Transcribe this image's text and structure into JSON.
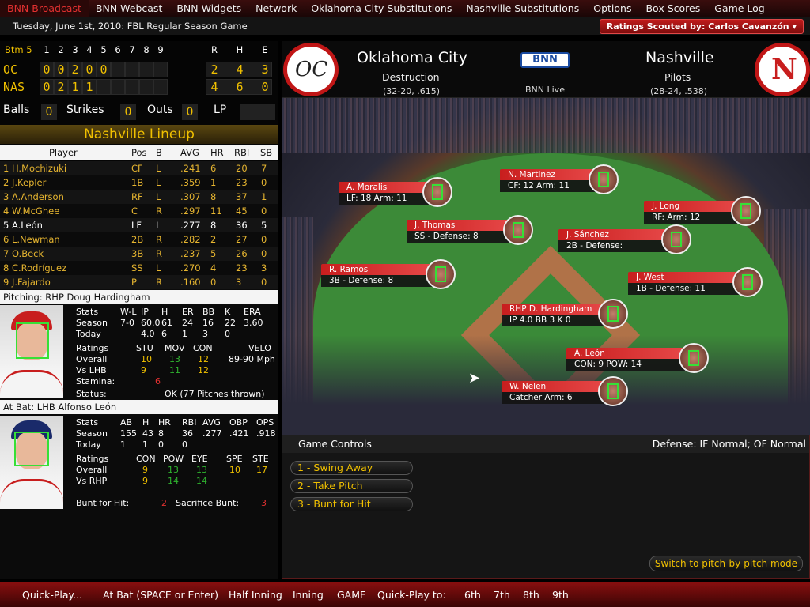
{
  "nav": {
    "tabs": [
      "BNN Broadcast",
      "BNN Webcast",
      "BNN Widgets",
      "Network",
      "Oklahoma City Substitutions",
      "Nashville Substitutions",
      "Options",
      "Box Scores",
      "Game Log"
    ],
    "date": "Tuesday, June 1st, 2010: FBL Regular Season Game",
    "scout": "Ratings Scouted by: Carlos Cavanzón"
  },
  "scoreboard": {
    "inning_label": "Btm 5",
    "innings": [
      "1",
      "2",
      "3",
      "4",
      "5",
      "6",
      "7",
      "8",
      "9"
    ],
    "rhe": [
      "R",
      "H",
      "E"
    ],
    "teams": [
      {
        "abbr": "OC",
        "runs": [
          "0",
          "0",
          "2",
          "0",
          "0"
        ],
        "r": "2",
        "h": "4",
        "e": "3"
      },
      {
        "abbr": "NAS",
        "runs": [
          "0",
          "2",
          "1",
          "1"
        ],
        "r": "4",
        "h": "6",
        "e": "0"
      }
    ],
    "balls_label": "Balls",
    "balls": "0",
    "strikes_label": "Strikes",
    "strikes": "0",
    "outs_label": "Outs",
    "outs": "0",
    "lp_label": "LP"
  },
  "lineup": {
    "title": "Nashville Lineup",
    "headers": [
      "Player",
      "Pos",
      "B",
      "AVG",
      "HR",
      "RBI",
      "SB"
    ],
    "rows": [
      [
        "1 H.Mochizuki",
        "CF",
        "L",
        ".241",
        "6",
        "20",
        "7"
      ],
      [
        "2 J.Kepler",
        "1B",
        "L",
        ".359",
        "1",
        "23",
        "0"
      ],
      [
        "3 A.Anderson",
        "RF",
        "L",
        ".307",
        "8",
        "37",
        "1"
      ],
      [
        "4 W.McGhee",
        "C",
        "R",
        ".297",
        "11",
        "45",
        "0"
      ],
      [
        "5 A.León",
        "LF",
        "L",
        ".277",
        "8",
        "36",
        "5"
      ],
      [
        "6 L.Newman",
        "2B",
        "R",
        ".282",
        "2",
        "27",
        "0"
      ],
      [
        "7 O.Beck",
        "3B",
        "R",
        ".237",
        "5",
        "26",
        "0"
      ],
      [
        "8 C.Rodríguez",
        "SS",
        "L",
        ".270",
        "4",
        "23",
        "3"
      ],
      [
        "9 J.Fajardo",
        "P",
        "R",
        ".160",
        "0",
        "3",
        "0"
      ]
    ]
  },
  "pitcher": {
    "header": "Pitching: RHP Doug Hardingham",
    "stat_heads": [
      "Stats",
      "W-L",
      "IP",
      "H",
      "ER",
      "BB",
      "K",
      "ERA"
    ],
    "season": [
      "Season",
      "7-0",
      "60.0",
      "61",
      "24",
      "16",
      "22",
      "3.60"
    ],
    "today": [
      "Today",
      "",
      "4.0",
      "6",
      "1",
      "3",
      "0",
      ""
    ],
    "rating_heads": [
      "Ratings",
      "STU",
      "MOV",
      "CON",
      "VELO"
    ],
    "overall": [
      "Overall",
      "10",
      "13",
      "12",
      "89-90 Mph"
    ],
    "vs": [
      "Vs LHB",
      "9",
      "11",
      "12"
    ],
    "stamina_label": "Stamina:",
    "stamina": "6",
    "status_label": "Status:",
    "status": "OK (77 Pitches thrown)"
  },
  "batter": {
    "header": "At Bat: LHB Alfonso León",
    "stat_heads": [
      "Stats",
      "AB",
      "H",
      "HR",
      "RBI",
      "AVG",
      "OBP",
      "OPS"
    ],
    "season": [
      "Season",
      "155",
      "43",
      "8",
      "36",
      ".277",
      ".421",
      ".918"
    ],
    "today": [
      "Today",
      "1",
      "1",
      "0",
      "0",
      "",
      "",
      ""
    ],
    "rating_heads": [
      "Ratings",
      "CON",
      "POW",
      "EYE",
      "SPE",
      "STE"
    ],
    "overall": [
      "Overall",
      "9",
      "13",
      "13",
      "10",
      "17"
    ],
    "vs": [
      "Vs RHP",
      "9",
      "14",
      "14",
      "",
      ""
    ],
    "bunt_label": "Bunt for Hit:",
    "bunt": "2",
    "sac_label": "Sacrifice Bunt:",
    "sac": "3"
  },
  "matchup": {
    "away": {
      "city": "Oklahoma City",
      "nick": "Destruction",
      "record": "(32-20, .615)"
    },
    "home": {
      "city": "Nashville",
      "nick": "Pilots",
      "record": "(28-24, .538)"
    },
    "network": "BNN",
    "live": "BNN Live"
  },
  "field": {
    "players": [
      {
        "name": "A. Moralis",
        "info": "LF: 18   Arm: 11"
      },
      {
        "name": "N. Martinez",
        "info": "CF: 12   Arm: 11"
      },
      {
        "name": "J. Long",
        "info": "RF:   Arm: 12"
      },
      {
        "name": "J. Thomas",
        "info": "SS - Defense: 8"
      },
      {
        "name": "J. Sánchez",
        "info": "2B - Defense:"
      },
      {
        "name": "R. Ramos",
        "info": "3B - Defense: 8"
      },
      {
        "name": "J. West",
        "info": "1B - Defense: 11"
      },
      {
        "name": "RHP D. Hardingham",
        "info": "IP 4.0  BB 3  K 0"
      },
      {
        "name": "A. León",
        "info": "CON: 9   POW: 14"
      },
      {
        "name": "W. Nelen",
        "info": "Catcher Arm: 6"
      }
    ]
  },
  "controls": {
    "title": "Game Controls",
    "defense": "Defense: IF Normal; OF Normal",
    "buttons": [
      "1 - Swing Away",
      "2 - Take Pitch",
      "3 - Bunt for Hit"
    ],
    "pbp": "Switch to pitch-by-pitch mode"
  },
  "bottom": {
    "items": [
      "Quick-Play...",
      "At Bat (SPACE or Enter)",
      "Half Inning",
      "Inning",
      "GAME",
      "Quick-Play to:",
      "6th",
      "7th",
      "8th",
      "9th"
    ]
  }
}
